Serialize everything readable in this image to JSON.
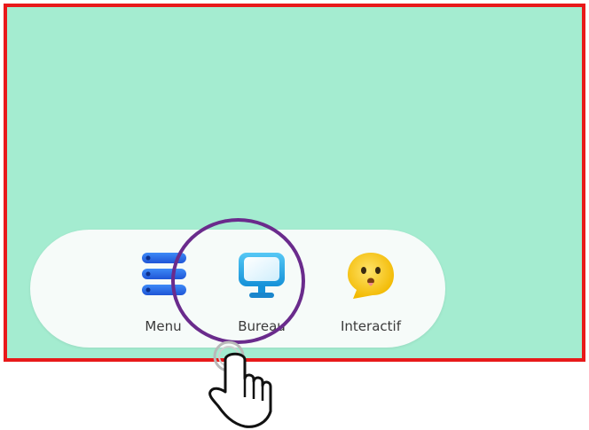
{
  "dock": {
    "items": [
      {
        "label": "Menu",
        "icon": "menu-stack-icon",
        "color": "#2f6fe0"
      },
      {
        "label": "Bureau",
        "icon": "monitor-icon",
        "color": "#1ca7e8"
      },
      {
        "label": "Interactif",
        "icon": "emoji-face-icon",
        "color": "#f5c518"
      }
    ]
  },
  "annotations": {
    "highlight_color": "#6a2b8c",
    "frame_color": "#e8191a",
    "background_color": "#a4ecd0",
    "pointer": "hand-pointer-icon"
  }
}
